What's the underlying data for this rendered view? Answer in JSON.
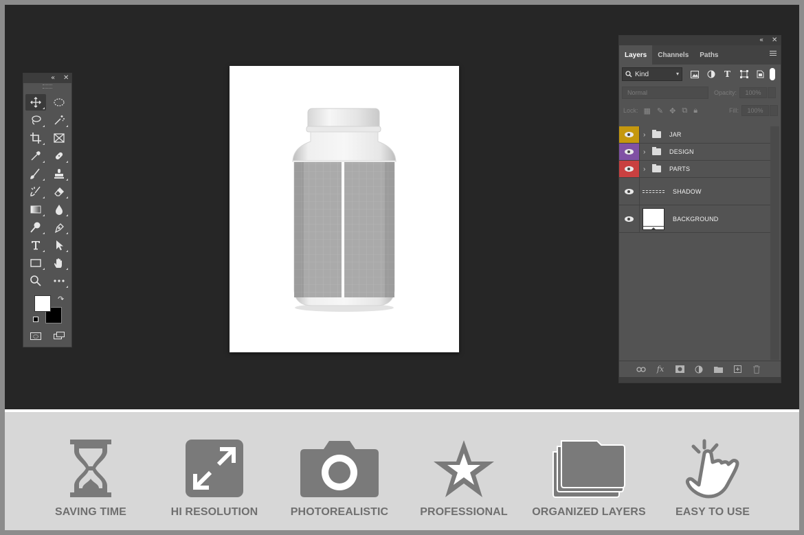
{
  "toolbox": {
    "collapse": "«",
    "close": "✕",
    "tools": [
      "move-tool",
      "ellipse-marquee-tool",
      "lasso-tool",
      "magic-wand-tool",
      "crop-tool",
      "frame-tool",
      "eyedropper-tool",
      "healing-brush-tool",
      "brush-tool",
      "clone-stamp-tool",
      "history-brush-tool",
      "eraser-tool",
      "gradient-tool",
      "blur-tool",
      "dodge-tool",
      "pen-tool",
      "type-tool",
      "path-selection-tool",
      "rectangle-tool",
      "hand-tool",
      "zoom-tool",
      "more-tools"
    ],
    "foreground_color": "#ffffff",
    "background_color": "#000000"
  },
  "layers_panel": {
    "collapse": "«",
    "close": "✕",
    "tabs": [
      {
        "label": "Layers",
        "active": true
      },
      {
        "label": "Channels",
        "active": false
      },
      {
        "label": "Paths",
        "active": false
      }
    ],
    "filter": {
      "kind_label": "Kind"
    },
    "blend_mode": "Normal",
    "opacity_label": "Opacity:",
    "opacity_value": "100%",
    "lock_label": "Lock:",
    "fill_label": "Fill:",
    "fill_value": "100%",
    "layers": [
      {
        "name": "JAR",
        "type": "group",
        "color": "#c5980e"
      },
      {
        "name": "DESIGN",
        "type": "group",
        "color": "#8051a4"
      },
      {
        "name": "PARTS",
        "type": "group",
        "color": "#c94040"
      },
      {
        "name": "SHADOW",
        "type": "layer",
        "color": ""
      },
      {
        "name": "BACKGROUND",
        "type": "layer",
        "color": ""
      }
    ],
    "footer_icons": [
      "link-icon",
      "fx-icon",
      "mask-icon",
      "adjustment-icon",
      "folder-icon",
      "new-layer-icon",
      "trash-icon"
    ],
    "footer_fx": "fx"
  },
  "features": [
    {
      "label": "SAVING TIME",
      "icon": "hourglass-icon"
    },
    {
      "label": "HI RESOLUTION",
      "icon": "expand-icon"
    },
    {
      "label": "PHOTOREALISTIC",
      "icon": "camera-icon"
    },
    {
      "label": "PROFESSIONAL",
      "icon": "star-icon"
    },
    {
      "label": "ORGANIZED LAYERS",
      "icon": "stacked-folders-icon"
    },
    {
      "label": "EASY TO USE",
      "icon": "tap-hand-icon"
    }
  ],
  "colors": {
    "workspace": "#262626",
    "panel": "#535353",
    "feature_icon": "#7a7a7a",
    "feature_text": "#6f6f6f"
  }
}
